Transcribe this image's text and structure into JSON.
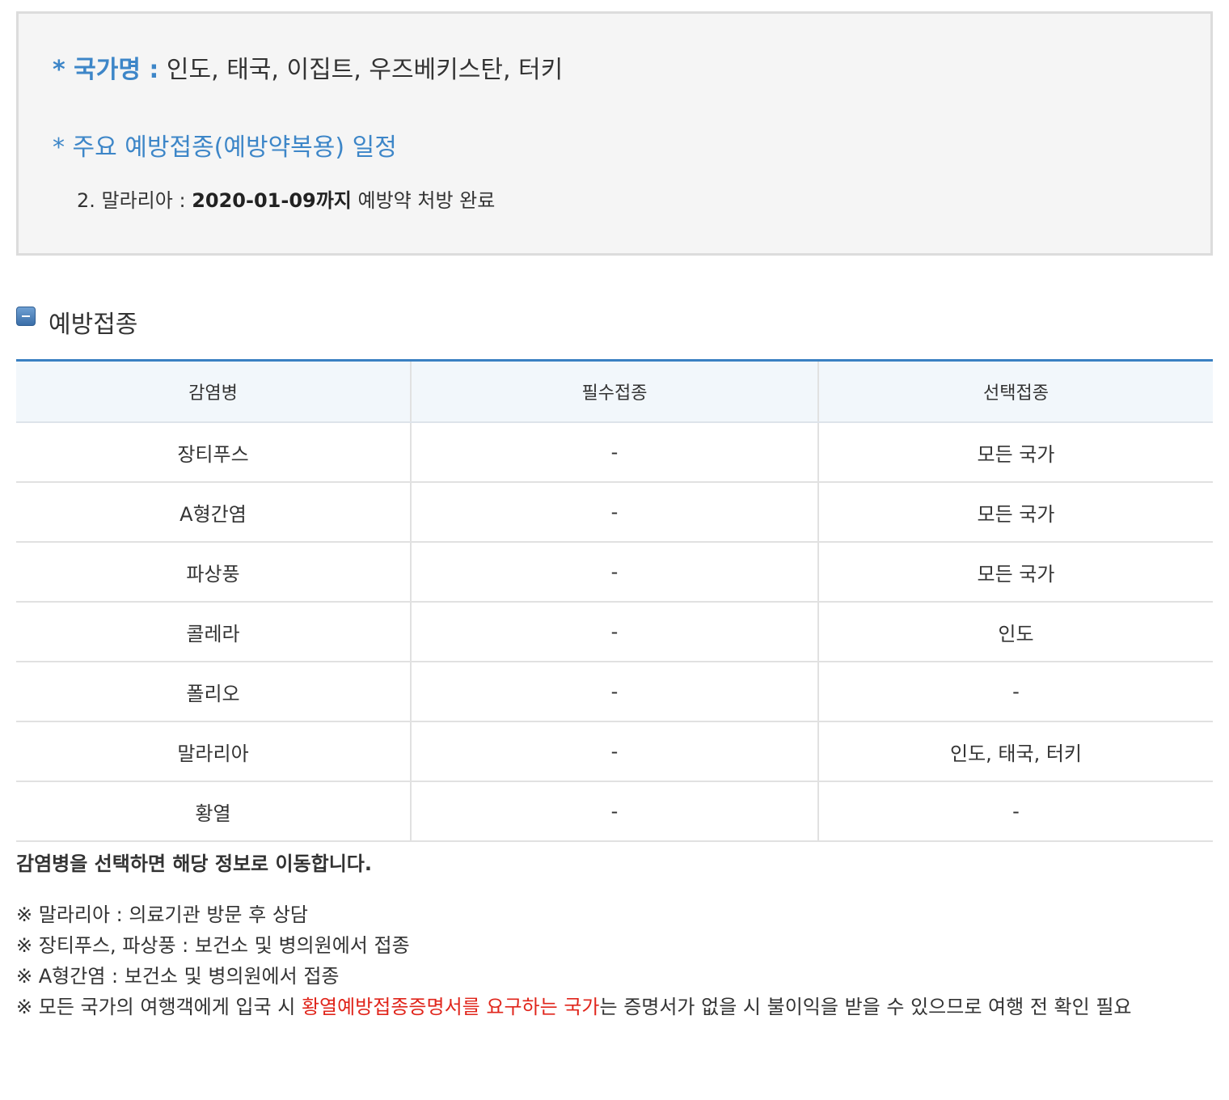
{
  "info": {
    "country_label": "* 국가명 :",
    "country_value": "인도, 태국, 이집트, 우즈베키스탄, 터키",
    "schedule_heading": "* 주요 예방접종(예방약복용) 일정",
    "schedule_item_prefix": "2. 말라리아 : ",
    "schedule_item_date": "2020-01-09까지",
    "schedule_item_suffix": " 예방약 처방 완료"
  },
  "section": {
    "title": "예방접종",
    "icon": "minus-icon"
  },
  "table": {
    "headers": [
      "감염병",
      "필수접종",
      "선택접종"
    ],
    "rows": [
      [
        "장티푸스",
        "-",
        "모든 국가"
      ],
      [
        "A형간염",
        "-",
        "모든 국가"
      ],
      [
        "파상풍",
        "-",
        "모든 국가"
      ],
      [
        "콜레라",
        "-",
        "인도"
      ],
      [
        "폴리오",
        "-",
        "-"
      ],
      [
        "말라리아",
        "-",
        "인도, 태국, 터키"
      ],
      [
        "황열",
        "-",
        "-"
      ]
    ]
  },
  "guide_text": "감염병을 선택하면 해당 정보로 이동합니다.",
  "notes": {
    "n1": "※ 말라리아 : 의료기관 방문 후 상담",
    "n2": "※ 장티푸스, 파상풍 : 보건소 및 병의원에서 접종",
    "n3": "※ A형간염 : 보건소 및 병의원에서 접종",
    "n4_prefix": "※ 모든 국가의 여행객에게 입국 시 ",
    "n4_highlight": "황열예방접종증명서를 요구하는 국가",
    "n4_suffix": "는 증명서가 없을 시 불이익을 받을 수 있으므로 여행 전 확인 필요"
  },
  "colors": {
    "accent_blue": "#3d86c8",
    "highlight_red": "#e0251b",
    "box_bg": "#f5f5f5"
  }
}
